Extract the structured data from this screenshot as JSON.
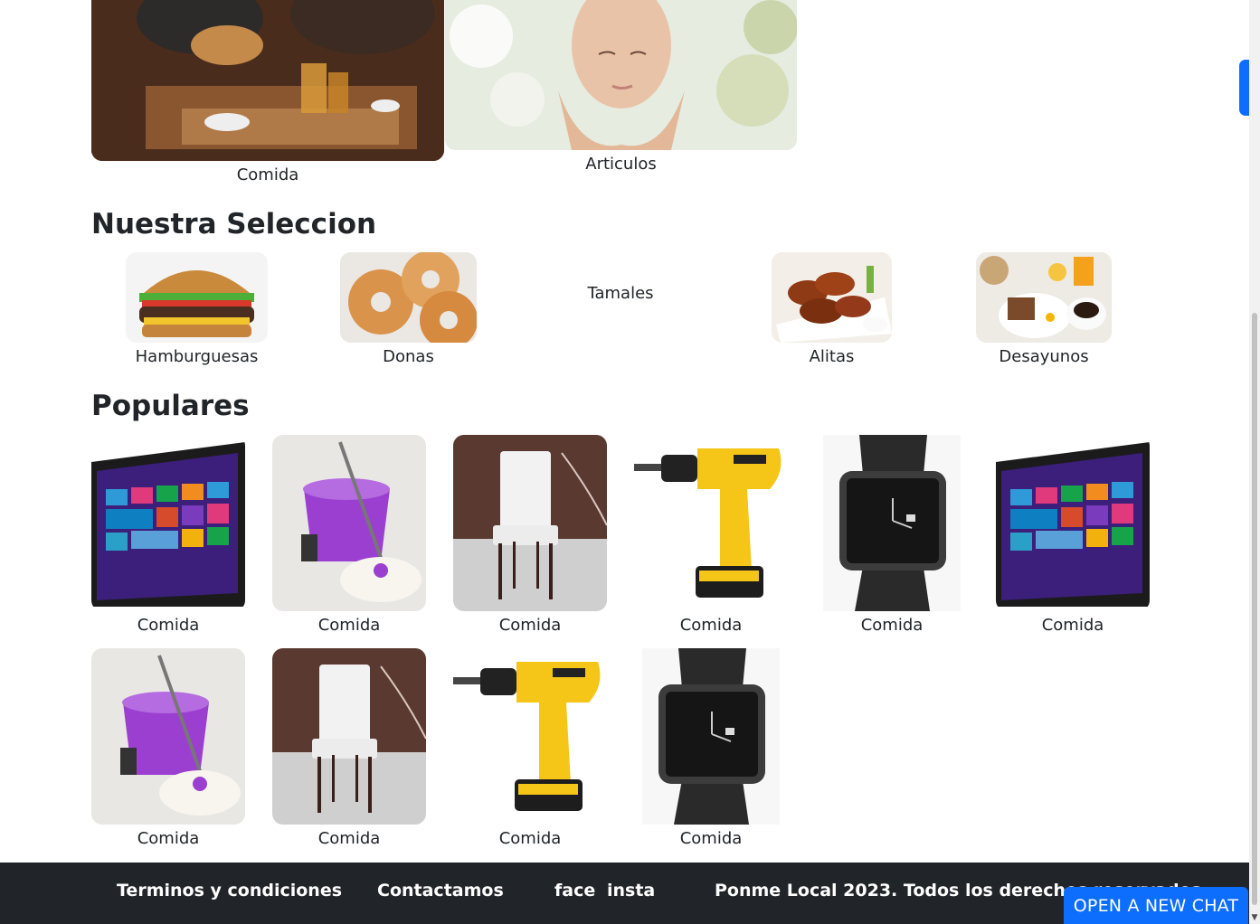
{
  "top_categories": [
    {
      "label": "Comida"
    },
    {
      "label": "Articulos"
    }
  ],
  "seleccion": {
    "title": "Nuestra Seleccion",
    "items": [
      {
        "label": "Hamburguesas"
      },
      {
        "label": "Donas"
      },
      {
        "label": "Tamales"
      },
      {
        "label": "Alitas"
      },
      {
        "label": "Desayunos"
      }
    ]
  },
  "populares": {
    "title": "Populares",
    "items": [
      {
        "label": "Comida",
        "image": "tablet"
      },
      {
        "label": "Comida",
        "image": "mop-bucket"
      },
      {
        "label": "Comida",
        "image": "chair"
      },
      {
        "label": "Comida",
        "image": "drill"
      },
      {
        "label": "Comida",
        "image": "watch"
      },
      {
        "label": "Comida",
        "image": "tablet"
      },
      {
        "label": "Comida",
        "image": "mop-bucket"
      },
      {
        "label": "Comida",
        "image": "chair"
      },
      {
        "label": "Comida",
        "image": "drill"
      },
      {
        "label": "Comida",
        "image": "watch"
      }
    ]
  },
  "footer": {
    "terms": "Terminos y condiciones",
    "contact": "Contactamos",
    "face": "face",
    "insta": "insta",
    "copyright": "Ponme Local 2023. Todos los derechos reservados"
  },
  "chat": {
    "label": "OPEN A NEW CHAT"
  },
  "colors": {
    "accent": "#0d6efd",
    "footer_bg": "#212529"
  }
}
